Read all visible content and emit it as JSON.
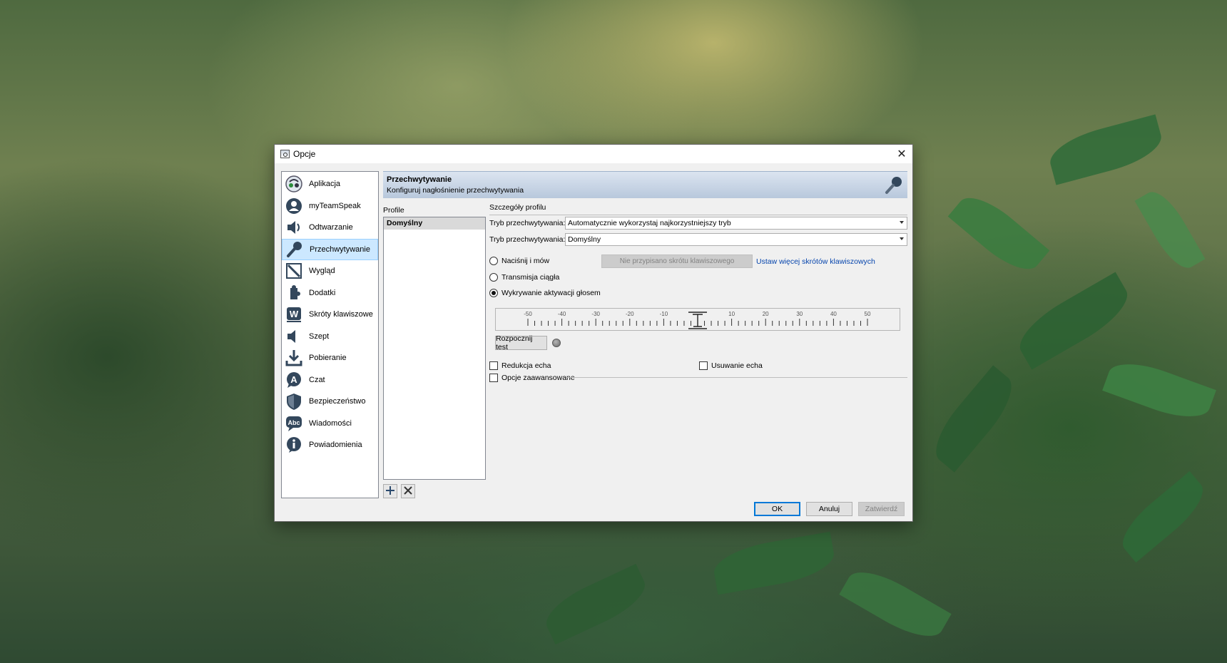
{
  "window": {
    "title": "Opcje"
  },
  "nav": {
    "items": [
      {
        "label": "Aplikacja",
        "icon": "teamspeak-logo-icon"
      },
      {
        "label": "myTeamSpeak",
        "icon": "user-account-icon"
      },
      {
        "label": "Odtwarzanie",
        "icon": "speaker-icon"
      },
      {
        "label": "Przechwytywanie",
        "icon": "microphone-icon",
        "active": true
      },
      {
        "label": "Wygląd",
        "icon": "design-icon"
      },
      {
        "label": "Dodatki",
        "icon": "plugin-icon"
      },
      {
        "label": "Skróty klawiszowe",
        "icon": "hotkey-icon"
      },
      {
        "label": "Szept",
        "icon": "whisper-icon"
      },
      {
        "label": "Pobieranie",
        "icon": "download-icon"
      },
      {
        "label": "Czat",
        "icon": "chat-icon"
      },
      {
        "label": "Bezpieczeństwo",
        "icon": "shield-icon"
      },
      {
        "label": "Wiadomości",
        "icon": "messages-icon"
      },
      {
        "label": "Powiadomienia",
        "icon": "info-icon"
      }
    ]
  },
  "header": {
    "title": "Przechwytywanie",
    "subtitle": "Konfiguruj nagłośnienie przechwytywania"
  },
  "profiles": {
    "label": "Profile",
    "items": [
      "Domyślny"
    ],
    "add_icon": "plus-icon",
    "remove_icon": "cross-icon"
  },
  "details": {
    "label": "Szczegóły profilu",
    "capture_mode_label": "Tryb przechwytywania:",
    "capture_mode_value": "Automatycznie wykorzystaj najkorzystniejszy tryb",
    "capture_device_label": "Tryb przechwytywania:",
    "capture_device_value": "Domyślny",
    "ptt_label": "Naciśnij i mów",
    "ptt_hotkey_button": "Nie przypisano skrótu klawiszowego",
    "ptt_more_link": "Ustaw więcej skrótów klawiszowych",
    "continuous_label": "Transmisja ciągła",
    "vad_label": "Wykrywanie aktywacji głosem",
    "selected_mode": "vad",
    "vad_scale": {
      "labels": [
        "-50",
        "-40",
        "-30",
        "-20",
        "-10",
        "10",
        "20",
        "30",
        "40",
        "50"
      ],
      "min": -50,
      "max": 50,
      "value": 0
    },
    "test_button": "Rozpocznij test",
    "echo_reduction_label": "Redukcja echa",
    "echo_cancel_label": "Usuwanie echa",
    "advanced_label": "Opcje zaawansowane"
  },
  "buttons": {
    "ok": "OK",
    "cancel": "Anuluj",
    "apply": "Zatwierdź"
  }
}
